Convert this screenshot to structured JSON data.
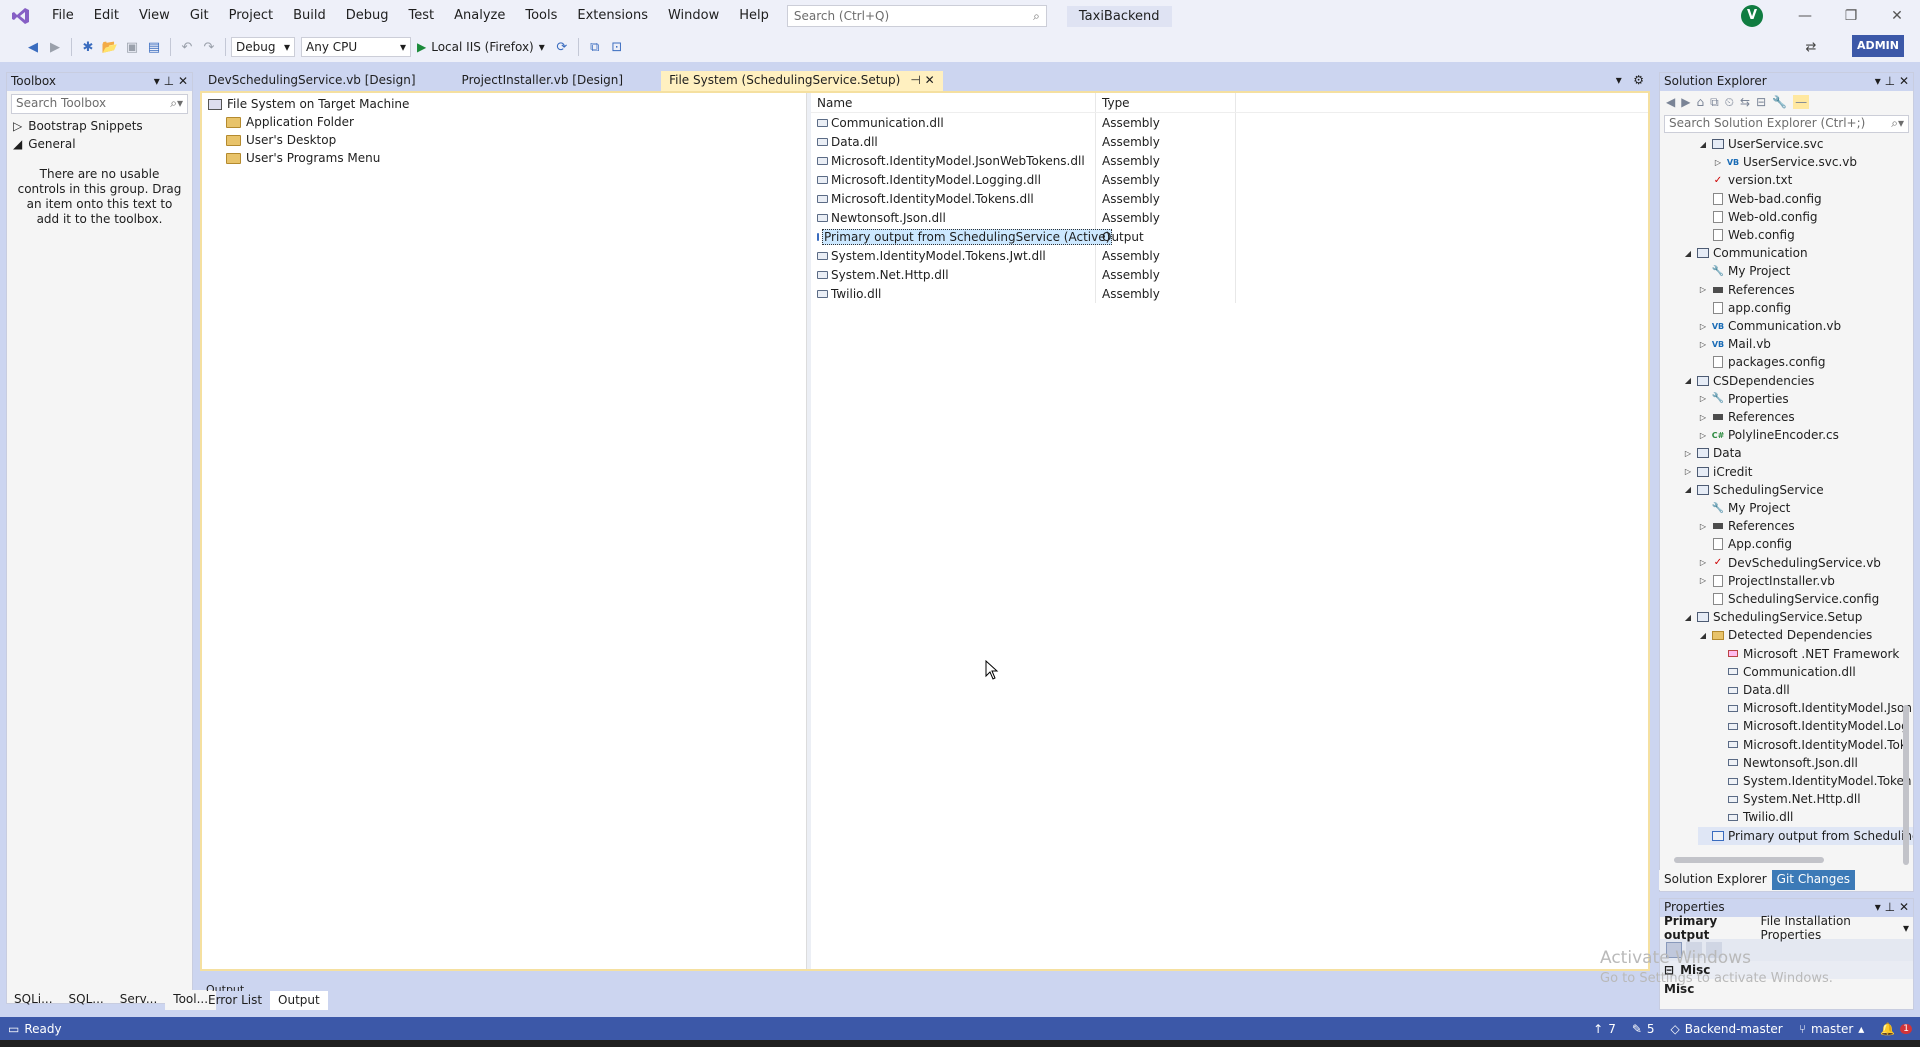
{
  "menu": [
    "File",
    "Edit",
    "View",
    "Git",
    "Project",
    "Build",
    "Debug",
    "Test",
    "Analyze",
    "Tools",
    "Extensions",
    "Window",
    "Help"
  ],
  "search_placeholder": "Search (Ctrl+Q)",
  "solution_name": "TaxiBackend",
  "avatar_initial": "V",
  "toolbar": {
    "config": "Debug",
    "platform": "Any CPU",
    "run_target": "Local IIS (Firefox)",
    "admin": "ADMIN"
  },
  "toolbox": {
    "title": "Toolbox",
    "search_placeholder": "Search Toolbox",
    "nodes": [
      {
        "expander": "▷",
        "label": "Bootstrap Snippets"
      },
      {
        "expander": "◢",
        "label": "General"
      }
    ],
    "empty_message": "There are no usable controls in this group. Drag an item onto this text to add it to the toolbox."
  },
  "bottom_tabs_left": [
    "SQLi...",
    "SQL...",
    "Serv...",
    "Tool..."
  ],
  "doc_tabs": [
    {
      "label": "DevSchedulingService.vb [Design]"
    },
    {
      "label": "ProjectInstaller.vb [Design]"
    },
    {
      "label": "File System (SchedulingService.Setup)"
    }
  ],
  "fs_tree": {
    "root": "File System on Target Machine",
    "folders": [
      "Application Folder",
      "User's Desktop",
      "User's Programs Menu"
    ]
  },
  "file_list": {
    "columns": [
      "Name",
      "Type"
    ],
    "rows": [
      {
        "name": "Communication.dll",
        "type": "Assembly"
      },
      {
        "name": "Data.dll",
        "type": "Assembly"
      },
      {
        "name": "Microsoft.IdentityModel.JsonWebTokens.dll",
        "type": "Assembly"
      },
      {
        "name": "Microsoft.IdentityModel.Logging.dll",
        "type": "Assembly"
      },
      {
        "name": "Microsoft.IdentityModel.Tokens.dll",
        "type": "Assembly"
      },
      {
        "name": "Newtonsoft.Json.dll",
        "type": "Assembly"
      },
      {
        "name": "Primary output from SchedulingService (Active)",
        "type": "Output"
      },
      {
        "name": "System.IdentityModel.Tokens.Jwt.dll",
        "type": "Assembly"
      },
      {
        "name": "System.Net.Http.dll",
        "type": "Assembly"
      },
      {
        "name": "Twilio.dll",
        "type": "Assembly"
      }
    ]
  },
  "output_tabs": {
    "header": "Output",
    "tabs": [
      "Error List",
      "Output"
    ]
  },
  "solution_explorer": {
    "title": "Solution Explorer",
    "search_placeholder": "Search Solution Explorer (Ctrl+;)",
    "items": [
      {
        "indent": 2,
        "exp": "◢",
        "icon": "proj",
        "label": "UserService.svc"
      },
      {
        "indent": 3,
        "exp": "▷",
        "icon": "vb",
        "label": "UserService.svc.vb"
      },
      {
        "indent": 2,
        "exp": "",
        "icon": "check",
        "label": "version.txt"
      },
      {
        "indent": 2,
        "exp": "",
        "icon": "file",
        "label": "Web-bad.config"
      },
      {
        "indent": 2,
        "exp": "",
        "icon": "file",
        "label": "Web-old.config"
      },
      {
        "indent": 2,
        "exp": "",
        "icon": "file",
        "label": "Web.config"
      },
      {
        "indent": 1,
        "exp": "◢",
        "icon": "proj",
        "label": "Communication"
      },
      {
        "indent": 2,
        "exp": "",
        "icon": "wrench",
        "label": "My Project"
      },
      {
        "indent": 2,
        "exp": "▷",
        "icon": "ref",
        "label": "References"
      },
      {
        "indent": 2,
        "exp": "",
        "icon": "file",
        "label": "app.config"
      },
      {
        "indent": 2,
        "exp": "▷",
        "icon": "vb",
        "label": "Communication.vb"
      },
      {
        "indent": 2,
        "exp": "▷",
        "icon": "vb",
        "label": "Mail.vb"
      },
      {
        "indent": 2,
        "exp": "",
        "icon": "file",
        "label": "packages.config"
      },
      {
        "indent": 1,
        "exp": "◢",
        "icon": "proj",
        "label": "CSDependencies"
      },
      {
        "indent": 2,
        "exp": "▷",
        "icon": "wrench",
        "label": "Properties"
      },
      {
        "indent": 2,
        "exp": "▷",
        "icon": "ref",
        "label": "References"
      },
      {
        "indent": 2,
        "exp": "▷",
        "icon": "cs",
        "label": "PolylineEncoder.cs"
      },
      {
        "indent": 1,
        "exp": "▷",
        "icon": "proj",
        "label": "Data"
      },
      {
        "indent": 1,
        "exp": "▷",
        "icon": "proj",
        "label": "iCredit"
      },
      {
        "indent": 1,
        "exp": "◢",
        "icon": "proj",
        "label": "SchedulingService"
      },
      {
        "indent": 2,
        "exp": "",
        "icon": "wrench",
        "label": "My Project"
      },
      {
        "indent": 2,
        "exp": "▷",
        "icon": "ref",
        "label": "References"
      },
      {
        "indent": 2,
        "exp": "",
        "icon": "file",
        "label": "App.config"
      },
      {
        "indent": 2,
        "exp": "▷",
        "icon": "check",
        "label": "DevSchedulingService.vb"
      },
      {
        "indent": 2,
        "exp": "▷",
        "icon": "file",
        "label": "ProjectInstaller.vb"
      },
      {
        "indent": 2,
        "exp": "",
        "icon": "file",
        "label": "SchedulingService.config"
      },
      {
        "indent": 1,
        "exp": "◢",
        "icon": "proj",
        "label": "SchedulingService.Setup"
      },
      {
        "indent": 2,
        "exp": "◢",
        "icon": "folder",
        "label": "Detected Dependencies"
      },
      {
        "indent": 3,
        "exp": "",
        "icon": "net",
        "label": "Microsoft .NET Framework"
      },
      {
        "indent": 3,
        "exp": "",
        "icon": "dll",
        "label": "Communication.dll"
      },
      {
        "indent": 3,
        "exp": "",
        "icon": "dll",
        "label": "Data.dll"
      },
      {
        "indent": 3,
        "exp": "",
        "icon": "dll",
        "label": "Microsoft.IdentityModel.Json"
      },
      {
        "indent": 3,
        "exp": "",
        "icon": "dll",
        "label": "Microsoft.IdentityModel.Log"
      },
      {
        "indent": 3,
        "exp": "",
        "icon": "dll",
        "label": "Microsoft.IdentityModel.Tok"
      },
      {
        "indent": 3,
        "exp": "",
        "icon": "dll",
        "label": "Newtonsoft.Json.dll"
      },
      {
        "indent": 3,
        "exp": "",
        "icon": "dll",
        "label": "System.IdentityModel.Token"
      },
      {
        "indent": 3,
        "exp": "",
        "icon": "dll",
        "label": "System.Net.Http.dll"
      },
      {
        "indent": 3,
        "exp": "",
        "icon": "dll",
        "label": "Twilio.dll"
      },
      {
        "indent": 2,
        "exp": "",
        "icon": "output",
        "label": "Primary output from Scheduling"
      }
    ],
    "tabs": [
      "Solution Explorer",
      "Git Changes"
    ]
  },
  "properties": {
    "title": "Properties",
    "object_name": "Primary output",
    "object_type": "File Installation Properties",
    "category": "Misc",
    "category_label": "Misc"
  },
  "watermark": {
    "line1": "Activate Windows",
    "line2": "Go to Settings to activate Windows."
  },
  "status": {
    "ready": "Ready",
    "up_count": "7",
    "pencil_count": "5",
    "repo": "Backend-master",
    "branch": "master",
    "notifications": "1"
  },
  "colors": {
    "accent": "#3c58a8",
    "active_tab": "#fff0c0",
    "selection": "#cce8ff"
  }
}
